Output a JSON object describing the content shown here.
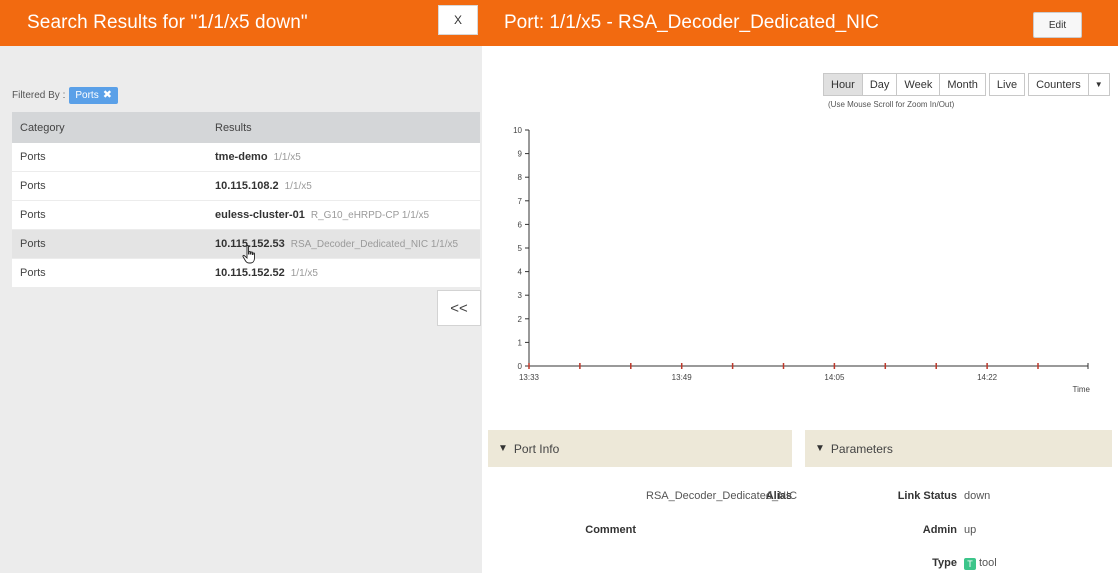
{
  "left": {
    "title": "Search Results for \"1/1/x5 down\"",
    "close_label": "X",
    "filter_label": "Filtered By :",
    "filter_chip": "Ports",
    "filter_chip_remove": "✖",
    "collapse_label": "<<",
    "table": {
      "headers": [
        "Category",
        "Results"
      ],
      "rows": [
        {
          "category": "Ports",
          "name": "tme-demo",
          "sub": "1/1/x5"
        },
        {
          "category": "Ports",
          "name": "10.115.108.2",
          "sub": "1/1/x5"
        },
        {
          "category": "Ports",
          "name": "euless-cluster-01",
          "sub": "R_G10_eHRPD-CP 1/1/x5"
        },
        {
          "category": "Ports",
          "name": "10.115.152.53",
          "sub": "RSA_Decoder_Dedicated_NIC 1/1/x5"
        },
        {
          "category": "Ports",
          "name": "10.115.152.52",
          "sub": "1/1/x5"
        }
      ]
    }
  },
  "right": {
    "title": "Port: 1/1/x5 - RSA_Decoder_Dedicated_NIC",
    "edit_label": "Edit",
    "ranges": [
      "Hour",
      "Day",
      "Week",
      "Month"
    ],
    "active_range": "Hour",
    "live_label": "Live",
    "counters_label": "Counters",
    "caret": "▼",
    "zoom_hint": "(Use Mouse Scroll for Zoom In/Out)",
    "port_info": {
      "heading": "Port Info",
      "alias_label": "Alias",
      "alias_value": "RSA_Decoder_Dedicated_NIC",
      "comment_label": "Comment"
    },
    "parameters": {
      "heading": "Parameters",
      "link_status_label": "Link Status",
      "link_status_value": "down",
      "admin_label": "Admin",
      "admin_value": "up",
      "type_label": "Type",
      "type_badge": "T",
      "type_value": "tool"
    }
  },
  "chart_data": {
    "type": "line",
    "title": "",
    "xlabel": "Time",
    "ylabel": "",
    "ylim": [
      0,
      10
    ],
    "yticks": [
      0,
      1,
      2,
      3,
      4,
      5,
      6,
      7,
      8,
      9,
      10
    ],
    "xtick_labels": [
      "13:33",
      "13:49",
      "14:05",
      "14:22"
    ],
    "series": [
      {
        "values": [
          0,
          0,
          0,
          0,
          0,
          0,
          0,
          0,
          0,
          0,
          0
        ]
      }
    ],
    "marker_color": "#c0392b"
  }
}
